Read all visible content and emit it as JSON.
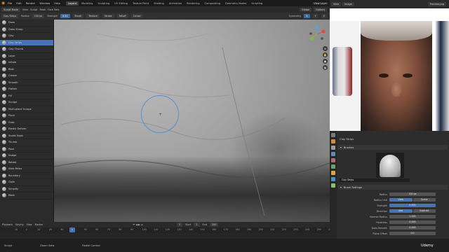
{
  "topbar": {
    "menu": [
      "File",
      "Edit",
      "Render",
      "Window",
      "Help"
    ],
    "tabs": [
      "Layout",
      "Modeling",
      "Sculpting",
      "UV Editing",
      "Texture Paint",
      "Shading",
      "Animation",
      "Rendering",
      "Compositing",
      "Geometry Nodes",
      "Scripting"
    ],
    "active_tab": "Layout",
    "right_chips": [
      "View Layer"
    ]
  },
  "header1": {
    "mode": "Sculpt Mode",
    "menus": [
      "View",
      "Sculpt",
      "Mask",
      "Face Sets"
    ],
    "right": [
      "Global",
      "Options"
    ]
  },
  "header2": {
    "brush": "Clay Strips",
    "radius_label": "Radius",
    "radius": "100 px",
    "strength_label": "Strength",
    "strength": "0.50",
    "right": [
      "Brush",
      "Texture",
      "Stroke",
      "Falloff",
      "Cursor"
    ],
    "symmetry": [
      "Symmetry",
      "X",
      "Y",
      "Z"
    ]
  },
  "brushes": [
    "Draw",
    "Draw Sharp",
    "Clay",
    "Clay Strips",
    "Clay Thumb",
    "Layer",
    "Inflate",
    "Blob",
    "Crease",
    "Smooth",
    "Flatten",
    "Fill",
    "Scrape",
    "Multi-plane Scrape",
    "Pinch",
    "Grab",
    "Elastic Deform",
    "Snake Hook",
    "Thumb",
    "Pose",
    "Nudge",
    "Rotate",
    "Slide Relax",
    "Boundary",
    "Cloth",
    "Simplify",
    "Mask"
  ],
  "selected_brush": "Clay Strips",
  "timeline": {
    "menus": [
      "Playback",
      "Keying",
      "View",
      "Marker"
    ],
    "start_label": "Start",
    "start": "1",
    "end_label": "End",
    "end": "250",
    "current_frame": "1",
    "ticks": [
      "-10",
      "0",
      "10",
      "20",
      "30",
      "40",
      "50",
      "60",
      "70",
      "80",
      "90",
      "100",
      "110",
      "120",
      "130",
      "140",
      "150",
      "160",
      "170",
      "180",
      "190",
      "200",
      "210",
      "220",
      "230",
      "240",
      "250",
      "260"
    ]
  },
  "status": {
    "items": [
      "Sculpt",
      "Zoom View",
      "Radial Control"
    ]
  },
  "refbar": {
    "items": [
      "View",
      "Image",
      "Preview.png"
    ]
  },
  "props": {
    "brush_name": "Clay Strips",
    "section_brushes": "Brushes",
    "brush_field": "Clay Strips",
    "section_settings": "Brush Settings",
    "rows": [
      {
        "label": "Radius",
        "value": "100 px"
      },
      {
        "label": "Radius Unit",
        "value": "View",
        "alt": "Scene"
      },
      {
        "label": "Strength",
        "value": "0.500"
      },
      {
        "label": "Direction",
        "value": "Add",
        "alt": "Subtract"
      },
      {
        "label": "Normal Radius",
        "value": "1.000"
      },
      {
        "label": "Hardness",
        "value": "0.000"
      },
      {
        "label": "Auto-Smooth",
        "value": "0.000"
      },
      {
        "label": "Plane Offset",
        "value": "0.0"
      },
      {
        "label": "Plane Trim",
        "value": "0.5"
      }
    ]
  },
  "watermark": "Udemy",
  "colors": {
    "accent": "#4772b3",
    "brush_cursor": "#5b8fd0",
    "blender_logo": "#e98c29"
  }
}
